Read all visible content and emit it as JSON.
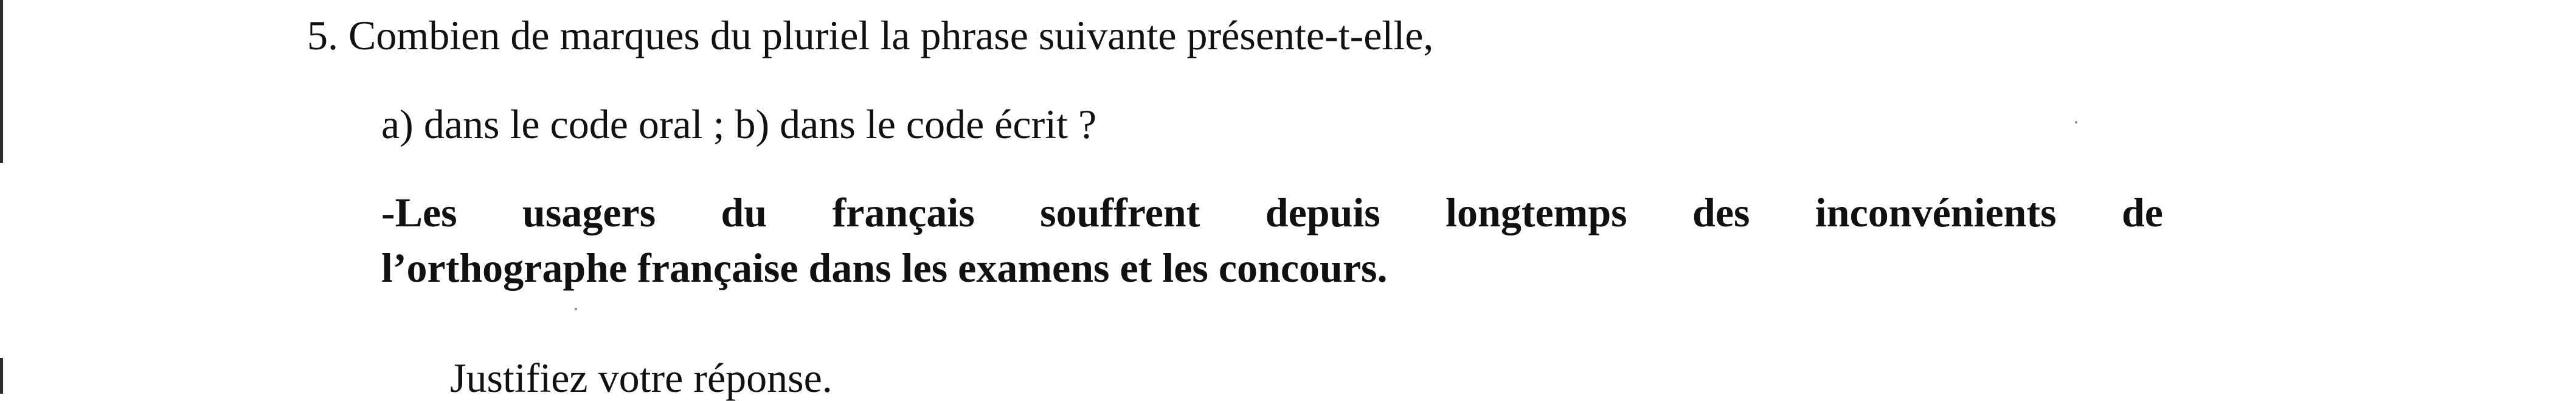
{
  "question": {
    "number": "5.",
    "text": "Combien de marques du pluriel la phrase suivante présente-t-elle,"
  },
  "subquestion": "a) dans le code oral ; b) dans le code écrit ?",
  "sentence": {
    "line1": "-Les usagers du français souffrent depuis longtemps des inconvénients de",
    "line2": "l’orthographe française dans les examens et les concours."
  },
  "instruction": "Justifiez votre réponse."
}
